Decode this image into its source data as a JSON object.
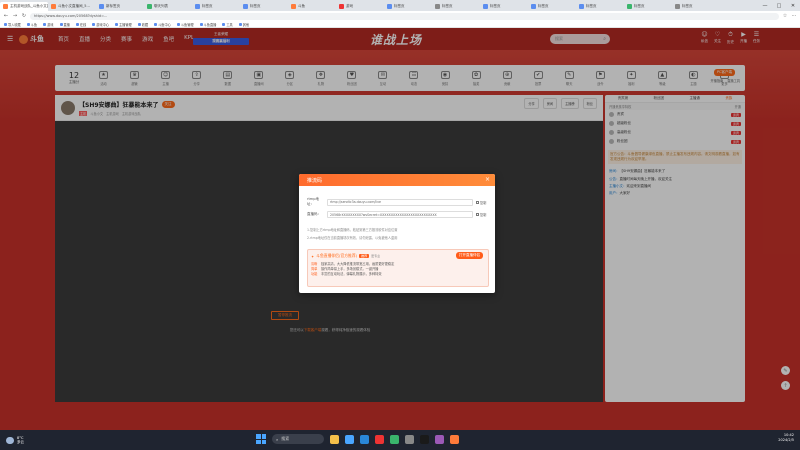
{
  "browser": {
    "tabs": [
      {
        "label": "主机游戏战队_斗鱼小文直播间_别...",
        "color": "#ff7b3a"
      },
      {
        "label": "斗鱼小文直播间_5...",
        "color": "#ff7b3a"
      },
      {
        "label": "新标签页",
        "color": "#5b8def"
      },
      {
        "label": "聊天列表",
        "color": "#3ab56c"
      },
      {
        "label": "标签页",
        "color": "#5b8def"
      },
      {
        "label": "标签页",
        "color": "#5b8def"
      },
      {
        "label": "斗鱼",
        "color": "#ff7b3a"
      },
      {
        "label": "游戏",
        "color": "#e33"
      },
      {
        "label": "标签页",
        "color": "#5b8def"
      },
      {
        "label": "标签页",
        "color": "#888"
      },
      {
        "label": "标签页",
        "color": "#5b8def"
      },
      {
        "label": "标签页",
        "color": "#5b8def"
      },
      {
        "label": "标签页",
        "color": "#5b8def"
      },
      {
        "label": "标签页",
        "color": "#3ab56c"
      },
      {
        "label": "标签页",
        "color": "#888"
      }
    ],
    "url": "https://www.douyu.com/20568?dyshid=...",
    "bookmarks": [
      "导入收藏",
      "斗鱼",
      "游戏",
      "直播",
      "在线",
      "游戏中心",
      "主播管理",
      "收藏",
      "斗鱼中心",
      "斗鱼管理",
      "斗鱼直播",
      "工具",
      "其他"
    ]
  },
  "site": {
    "logo": "斗鱼",
    "nav": [
      "首页",
      "直播",
      "分类",
      "赛事",
      "游戏",
      "鱼吧",
      "KPL"
    ],
    "banner_top": "王者荣耀",
    "banner_btn": "观赛赢福利",
    "slogan": "谁战上场",
    "search_placeholder": "搜索",
    "right_nav": [
      {
        "icon": "☺",
        "label": "私信"
      },
      {
        "icon": "♡",
        "label": "关注"
      },
      {
        "icon": "⏱",
        "label": "历史"
      },
      {
        "icon": "▶",
        "label": "开播"
      },
      {
        "icon": "☰",
        "label": "任务"
      }
    ]
  },
  "giftbar": {
    "score_value": "12",
    "score_label": "主播分",
    "gifts": [
      "活动",
      "超管",
      "主播",
      "分享",
      "数据",
      "直播间",
      "分区",
      "礼物",
      "粉丝团",
      "互动",
      "动态",
      "竞猜",
      "抽奖",
      "贡献",
      "投票",
      "聊天",
      "战令",
      "福利",
      "等级",
      "主题",
      "更多"
    ],
    "pc_btn": "PC客户端",
    "pc_sub": [
      "开播指南",
      "直播工具"
    ]
  },
  "room": {
    "title": "【SH9安娜曲】狂暴能本来了",
    "follow": "关注",
    "tag": "主机",
    "meta": [
      "斗鱼小文",
      "主机游戏",
      "主机游戏战队"
    ],
    "buttons": [
      "分享",
      "房间",
      "主播榜",
      "粉丝"
    ],
    "no_push": "暂停推流",
    "tip_prefix": "您还可以",
    "tip_link": "下载客户端",
    "tip_suffix": "观看，获得纯净极速的观看体验"
  },
  "chat": {
    "tabs": [
      "贵宾席",
      "粉丝团",
      "主播通",
      "贵族"
    ],
    "fans_note": "开通贵族享特权",
    "fans_action": "开通",
    "fans": [
      {
        "name": "贵宾",
        "badge": "贵宾"
      },
      {
        "name": "超级粉丝",
        "badge": "贵宾"
      },
      {
        "name": "高级粉丝",
        "badge": "贵宾"
      },
      {
        "name": "粉丝团",
        "badge": "贵宾"
      }
    ],
    "notice": "官方公告：斗鱼倡导健康绿色直播，禁止主播发布违规内容。请文明观看直播，如有发现违规行为欢迎举报。",
    "messages": [
      {
        "name": "房间：",
        "text": "【SH9安娜曲】狂暴能本来了"
      },
      {
        "name": "公告：",
        "text": "直播时间每天晚上开播，欢迎关注"
      },
      {
        "name": "主播小文：",
        "text": "欢迎来到直播间"
      },
      {
        "name": "用户：",
        "text": "大家好"
      }
    ]
  },
  "dialog": {
    "title": "推流码",
    "close": "×",
    "rtmp_label": "rtmp地址：",
    "rtmp_value": "rtmp://sendtc3a.douyu.com/live",
    "code_label": "直播码：",
    "code_value": "20568rXXXXXXXXX?wsSecret=XXXXXXXXXXXXXXXXXXXXXXXXXX",
    "copy": "复制",
    "hint1": "1.复制上方rtmp地址和直播码，粘贴到第三方推流软件对应位置",
    "hint2": "2.rtmp地址仅在当前直播场次有效，请勿泄露，以免被他人盗用",
    "promo_title": "斗鱼直播伴侣(官方推荐)",
    "promo_tag": "推荐",
    "promo_sub": "更专业",
    "promo_btn": "打开直播伴侣",
    "lines": [
      {
        "k": "清晰",
        "v": "独家高清，大大降低推流带宽占用，画质更好更稳定"
      },
      {
        "k": "简单",
        "v": "操作简单易上手，多场景模式，一键开播"
      },
      {
        "k": "功能",
        "v": "丰富的互动玩法，弹幕礼物展示，多种特效"
      }
    ]
  },
  "taskbar": {
    "temp": "8°C",
    "weather": "多云",
    "search": "搜索",
    "apps": [
      "#f5c04a",
      "#4aa6ff",
      "#2a87d8",
      "#e33",
      "#3ab56c",
      "#888",
      "#1a1a1a",
      "#9b59b6",
      "#ff7b3a"
    ],
    "time": "10:42",
    "date": "2024/2/5"
  }
}
